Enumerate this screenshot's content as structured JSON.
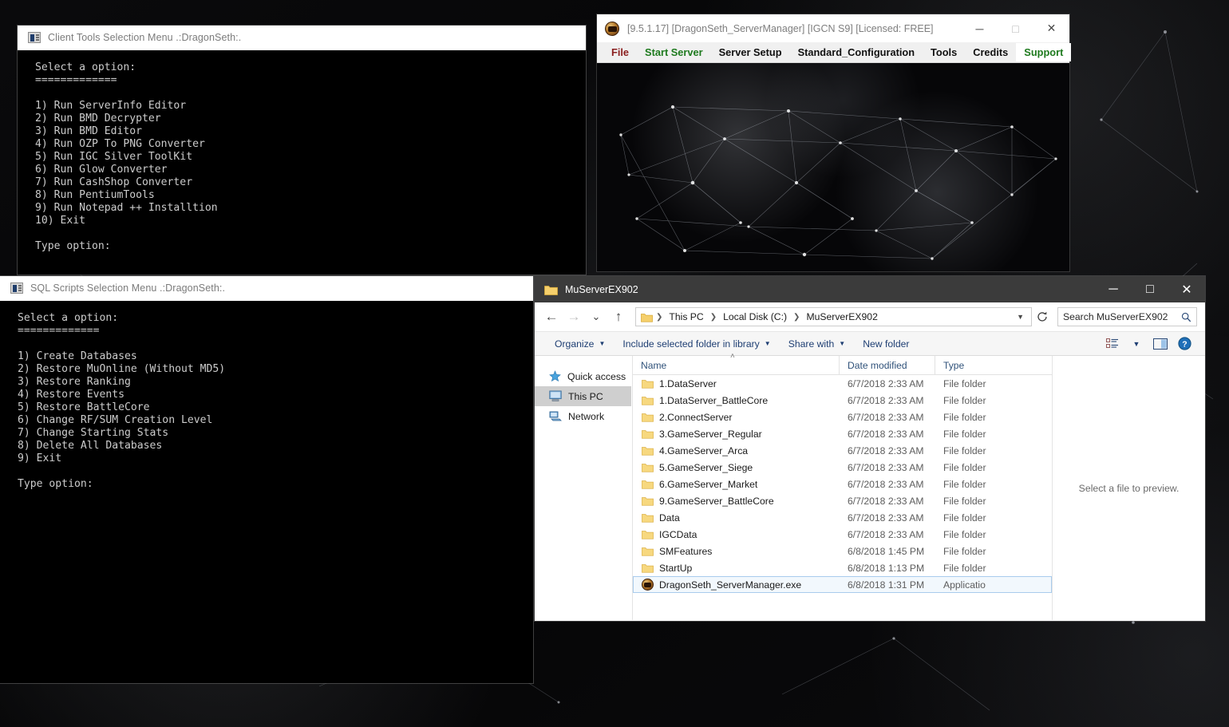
{
  "desktop": {
    "background_color": "#070708"
  },
  "client_tools_console": {
    "title": "Client Tools Selection Menu .:DragonSeth:.",
    "icon": "console-icon",
    "body": "Select a option:\n=============\n\n1) Run ServerInfo Editor\n2) Run BMD Decrypter\n3) Run BMD Editor\n4) Run OZP To PNG Converter\n5) Run IGC Silver ToolKit\n6) Run Glow Converter\n7) Run CashShop Converter\n8) Run PentiumTools\n9) Run Notepad ++ Installtion\n10) Exit\n\nType option:"
  },
  "sql_scripts_console": {
    "title": "SQL Scripts Selection Menu .:DragonSeth:.",
    "icon": "console-icon",
    "body": "Select a option:\n=============\n\n1) Create Databases\n2) Restore MuOnline (Without MD5)\n3) Restore Ranking\n4) Restore Events\n5) Restore BattleCore\n6) Change RF/SUM Creation Level\n7) Change Starting Stats\n8) Delete All Databases\n9) Exit\n\nType option:"
  },
  "server_manager": {
    "title": "[9.5.1.17] [DragonSeth_ServerManager] [IGCN S9] [Licensed: FREE]",
    "icon": "dragonseth-app-icon",
    "window_controls": {
      "minimize": "─",
      "maximize": "□",
      "close": "✕"
    },
    "menu": [
      {
        "label": "File",
        "color": "#8b2020"
      },
      {
        "label": "Start Server",
        "color": "#1e7a1e"
      },
      {
        "label": "Server Setup",
        "color": "#111111"
      },
      {
        "label": "Standard_Configuration",
        "color": "#111111"
      },
      {
        "label": "Tools",
        "color": "#111111"
      },
      {
        "label": "Credits",
        "color": "#111111"
      },
      {
        "label": "Support",
        "color": "#1e7a1e",
        "highlighted": true
      }
    ]
  },
  "explorer": {
    "title": "MuServerEX902",
    "window_controls": {
      "minimize": "─",
      "maximize": "□",
      "close": "✕"
    },
    "nav_buttons": {
      "back": "←",
      "forward": "→",
      "recent": "⌄",
      "up": "↑"
    },
    "breadcrumb": [
      "This PC",
      "Local Disk (C:)",
      "MuServerEX902"
    ],
    "breadcrumb_separator": "❯",
    "refresh_icon": "refresh-icon",
    "search": {
      "placeholder": "Search MuServerEX902",
      "icon": "search-icon"
    },
    "toolbar": [
      {
        "label": "Organize",
        "has_caret": true
      },
      {
        "label": "Include selected folder in library",
        "has_caret": true
      },
      {
        "label": "Share with",
        "has_caret": true
      },
      {
        "label": "New folder",
        "has_caret": false
      }
    ],
    "toolbar_right_icons": [
      "view-options-icon",
      "view-caret-icon",
      "preview-pane-icon",
      "help-icon"
    ],
    "nav_pane": [
      {
        "label": "Quick access",
        "icon": "star-icon",
        "selected": false
      },
      {
        "label": "This PC",
        "icon": "computer-icon",
        "selected": true
      },
      {
        "label": "Network",
        "icon": "network-icon",
        "selected": false
      }
    ],
    "columns": [
      "Name",
      "Date modified",
      "Type"
    ],
    "sort_indicator": "˄",
    "files": [
      {
        "name": "1.DataServer",
        "date": "6/7/2018 2:33 AM",
        "type": "File folder",
        "icon": "folder-icon",
        "selected": false
      },
      {
        "name": "1.DataServer_BattleCore",
        "date": "6/7/2018 2:33 AM",
        "type": "File folder",
        "icon": "folder-icon",
        "selected": false
      },
      {
        "name": "2.ConnectServer",
        "date": "6/7/2018 2:33 AM",
        "type": "File folder",
        "icon": "folder-icon",
        "selected": false
      },
      {
        "name": "3.GameServer_Regular",
        "date": "6/7/2018 2:33 AM",
        "type": "File folder",
        "icon": "folder-icon",
        "selected": false
      },
      {
        "name": "4.GameServer_Arca",
        "date": "6/7/2018 2:33 AM",
        "type": "File folder",
        "icon": "folder-icon",
        "selected": false
      },
      {
        "name": "5.GameServer_Siege",
        "date": "6/7/2018 2:33 AM",
        "type": "File folder",
        "icon": "folder-icon",
        "selected": false
      },
      {
        "name": "6.GameServer_Market",
        "date": "6/7/2018 2:33 AM",
        "type": "File folder",
        "icon": "folder-icon",
        "selected": false
      },
      {
        "name": "9.GameServer_BattleCore",
        "date": "6/7/2018 2:33 AM",
        "type": "File folder",
        "icon": "folder-icon",
        "selected": false
      },
      {
        "name": "Data",
        "date": "6/7/2018 2:33 AM",
        "type": "File folder",
        "icon": "folder-icon",
        "selected": false
      },
      {
        "name": "IGCData",
        "date": "6/7/2018 2:33 AM",
        "type": "File folder",
        "icon": "folder-icon",
        "selected": false
      },
      {
        "name": "SMFeatures",
        "date": "6/8/2018 1:45 PM",
        "type": "File folder",
        "icon": "folder-icon",
        "selected": false
      },
      {
        "name": "StartUp",
        "date": "6/8/2018 1:13 PM",
        "type": "File folder",
        "icon": "folder-icon",
        "selected": false
      },
      {
        "name": "DragonSeth_ServerManager.exe",
        "date": "6/8/2018 1:31 PM",
        "type": "Applicatio",
        "icon": "exe-icon",
        "selected": true
      }
    ],
    "preview_pane": {
      "message": "Select a file to preview."
    }
  }
}
